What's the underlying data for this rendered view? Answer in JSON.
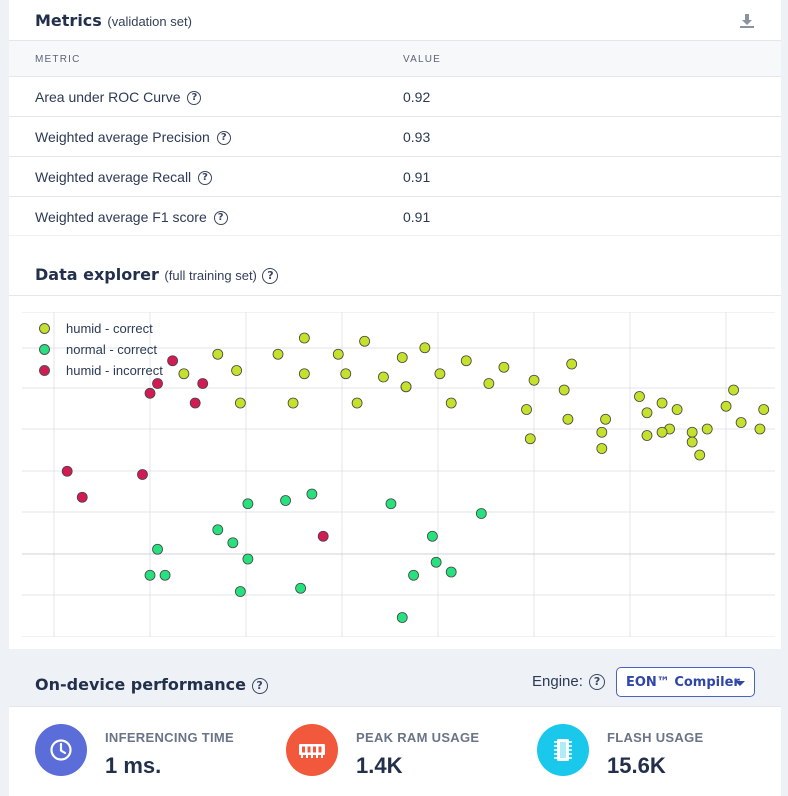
{
  "metrics": {
    "title": "Metrics",
    "subtitle": "(validation set)",
    "download_icon": "download-icon",
    "columns": [
      "METRIC",
      "VALUE"
    ],
    "rows": [
      {
        "metric": "Area under ROC Curve",
        "value": "0.92"
      },
      {
        "metric": "Weighted average Precision",
        "value": "0.93"
      },
      {
        "metric": "Weighted average Recall",
        "value": "0.91"
      },
      {
        "metric": "Weighted average F1 score",
        "value": "0.91"
      }
    ]
  },
  "explorer": {
    "title": "Data explorer",
    "subtitle": "(full training set)"
  },
  "chart_data": {
    "type": "scatter",
    "grid": true,
    "xlim": [
      0,
      100
    ],
    "ylim": [
      0,
      100
    ],
    "legend": "top-left",
    "series": [
      {
        "name": "humid - correct",
        "color": "#c6e12b",
        "points": [
          [
            26,
            87
          ],
          [
            34,
            87
          ],
          [
            37.5,
            92
          ],
          [
            42,
            87
          ],
          [
            45.5,
            91
          ],
          [
            50.5,
            86
          ],
          [
            53.5,
            89
          ],
          [
            21.5,
            81
          ],
          [
            28.5,
            82
          ],
          [
            37.5,
            81
          ],
          [
            43,
            81
          ],
          [
            48,
            80
          ],
          [
            51,
            77
          ],
          [
            55.5,
            81
          ],
          [
            59,
            85
          ],
          [
            62,
            78
          ],
          [
            64,
            83
          ],
          [
            68,
            79
          ],
          [
            73,
            84
          ],
          [
            72,
            76
          ],
          [
            51,
            77
          ],
          [
            29,
            72
          ],
          [
            36,
            72
          ],
          [
            44.5,
            72
          ],
          [
            57,
            72
          ],
          [
            67,
            70
          ],
          [
            72.5,
            67
          ],
          [
            77.5,
            67
          ],
          [
            82,
            74
          ],
          [
            83,
            69
          ],
          [
            83,
            62
          ],
          [
            85,
            72
          ],
          [
            87,
            70
          ],
          [
            89,
            63
          ],
          [
            89,
            60
          ],
          [
            91,
            64
          ],
          [
            93.5,
            71
          ],
          [
            94.5,
            76
          ],
          [
            95.5,
            66
          ],
          [
            98,
            64
          ],
          [
            98.5,
            70
          ],
          [
            86,
            64
          ],
          [
            67.5,
            61
          ],
          [
            77,
            63
          ],
          [
            77,
            58
          ],
          [
            85,
            63
          ],
          [
            90,
            56
          ],
          [
            101,
            56
          ]
        ]
      },
      {
        "name": "normal - correct",
        "color": "#27e07e",
        "points": [
          [
            30,
            41
          ],
          [
            35,
            42
          ],
          [
            38.5,
            44
          ],
          [
            49,
            41
          ],
          [
            61,
            38
          ],
          [
            26,
            33
          ],
          [
            18,
            27
          ],
          [
            28,
            29
          ],
          [
            54.5,
            31
          ],
          [
            57,
            20
          ],
          [
            17,
            19
          ],
          [
            19,
            19
          ],
          [
            37,
            15
          ],
          [
            50.5,
            6
          ],
          [
            29,
            14
          ],
          [
            30,
            24
          ],
          [
            52,
            19
          ],
          [
            55,
            23
          ]
        ]
      },
      {
        "name": "humid - incorrect",
        "color": "#d21b55",
        "points": [
          [
            20,
            85
          ],
          [
            18,
            78
          ],
          [
            24,
            78
          ],
          [
            17,
            75
          ],
          [
            23,
            72
          ],
          [
            6,
            51
          ],
          [
            8,
            43
          ],
          [
            16,
            50
          ],
          [
            40,
            31
          ]
        ]
      }
    ]
  },
  "perf": {
    "title": "On-device performance",
    "engine_label": "Engine:",
    "engine_value": "EON™ Compiler",
    "stats": [
      {
        "label": "INFERENCING TIME",
        "value": "1 ms.",
        "icon": "clock-icon",
        "color": "#5b6dd8"
      },
      {
        "label": "PEAK RAM USAGE",
        "value": "1.4K",
        "icon": "ram-chip-icon",
        "color": "#f2583b"
      },
      {
        "label": "FLASH USAGE",
        "value": "15.6K",
        "icon": "flash-chip-icon",
        "color": "#19c8ea"
      }
    ]
  }
}
